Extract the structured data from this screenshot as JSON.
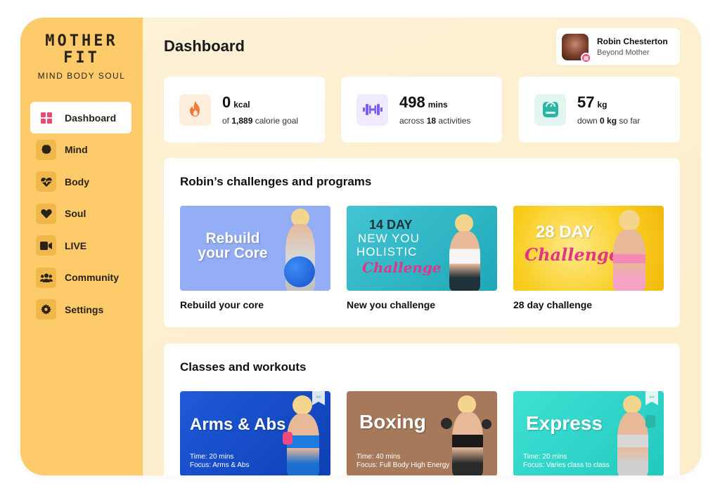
{
  "logo": {
    "line1": "MOTHER",
    "line2": "FIT",
    "tagline": "MIND BODY SOUL"
  },
  "nav": [
    {
      "label": "Dashboard",
      "icon": "grid-icon",
      "active": true
    },
    {
      "label": "Mind",
      "icon": "brain-icon"
    },
    {
      "label": "Body",
      "icon": "heartbeat-icon"
    },
    {
      "label": "Soul",
      "icon": "heart-icon"
    },
    {
      "label": "LIVE",
      "icon": "video-camera-icon"
    },
    {
      "label": "Community",
      "icon": "users-icon"
    },
    {
      "label": "Settings",
      "icon": "gear-icon"
    }
  ],
  "header": {
    "title": "Dashboard"
  },
  "profile": {
    "name": "Robin Chesterton",
    "subtitle": "Beyond Mother"
  },
  "stats": [
    {
      "value": "0",
      "unit": "kcal",
      "sub_pre": "of ",
      "sub_bold": "1,889",
      "sub_post": " calorie goal",
      "icon": "flame-icon",
      "color": "#f47a3a"
    },
    {
      "value": "498",
      "unit": "mins",
      "sub_pre": "across ",
      "sub_bold": "18",
      "sub_post": " activities",
      "icon": "dumbbell-icon",
      "color": "#7b5cf0"
    },
    {
      "value": "57",
      "unit": "kg",
      "sub_pre": "down ",
      "sub_bold": "0 kg",
      "sub_post": " so far",
      "icon": "scale-icon",
      "color": "#2bb5a5"
    }
  ],
  "challenges": {
    "title": "Robin’s challenges and programs",
    "items": [
      {
        "thumb_text": "Rebuild your Core",
        "label": "Rebuild your core"
      },
      {
        "thumb_line1": "14 DAY",
        "thumb_line2": "NEW YOU",
        "thumb_line3": "HOLISTIC",
        "thumb_line4": "Challenge",
        "label": "New you challenge"
      },
      {
        "thumb_line1": "28 DAY",
        "thumb_line2": "Challenge",
        "label": "28 day challenge"
      }
    ]
  },
  "classes": {
    "title": "Classes and workouts",
    "items": [
      {
        "name": "Arms & Abs",
        "time": "Time:   20 mins",
        "focus": "Focus:  Arms & Abs"
      },
      {
        "name": "Boxing",
        "time": "Time:   40 mins",
        "focus": "Focus:  Full Body High Energy"
      },
      {
        "name": "Express",
        "time": "Time:   20 mins",
        "focus": "Focus:  Varies class to class"
      }
    ]
  },
  "colors": {
    "sidebar": "#fdcb6a",
    "accent_pink": "#e84a73",
    "background": "#fdf0d2"
  }
}
